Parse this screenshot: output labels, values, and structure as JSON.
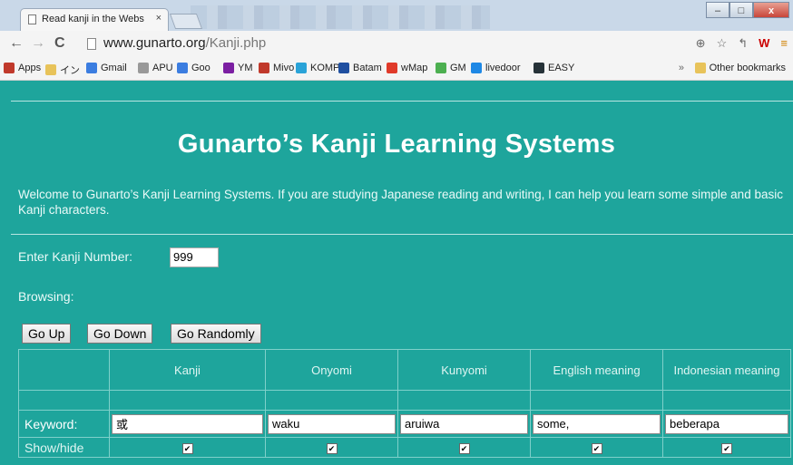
{
  "browser": {
    "tab_title": "Read kanji in the Webs",
    "tab_close": "×",
    "url_domain": "www.gunarto.org",
    "url_path": "/Kanji.php",
    "window_controls": [
      "–",
      "□",
      "x"
    ]
  },
  "bookmarks": [
    {
      "label": "Apps",
      "icon": "apps-icon",
      "color": "#c0392b"
    },
    {
      "label": "イン",
      "icon": "folder-icon",
      "color": "#e8c35a"
    },
    {
      "label": "Gmail",
      "icon": "google-icon",
      "color": "#3b7de0"
    },
    {
      "label": "APU",
      "icon": "page-icon",
      "color": "#999999"
    },
    {
      "label": "Goo",
      "icon": "google-icon",
      "color": "#3b7de0"
    },
    {
      "label": "YM",
      "icon": "yahoo-icon",
      "color": "#7b1fa2"
    },
    {
      "label": "Mivo",
      "icon": "mivo-icon",
      "color": "#c0392b"
    },
    {
      "label": "KOMP",
      "icon": "kompas-icon",
      "color": "#2aa3d8"
    },
    {
      "label": "Batam",
      "icon": "batam-icon",
      "color": "#1f4fa0"
    },
    {
      "label": "wMap",
      "icon": "wmap-icon",
      "color": "#e03a2a"
    },
    {
      "label": "GM",
      "icon": "gm-icon",
      "color": "#4caf50"
    },
    {
      "label": "livedoor",
      "icon": "livedoor-icon",
      "color": "#1e88e5"
    },
    {
      "label": "EASY",
      "icon": "easy-icon",
      "color": "#263238"
    }
  ],
  "bookmarks_overflow": "»",
  "other_bookmarks": "Other bookmarks",
  "page": {
    "title": "Gunarto’s Kanji Learning Systems",
    "welcome": "Welcome to Gunarto’s Kanji Learning Systems. If you are studying Japanese reading and writing, I can help you learn some simple and basic Kanji characters.",
    "kanji_number_label": "Enter Kanji Number:",
    "kanji_number_value": "999",
    "browsing_label": "Browsing:",
    "buttons": {
      "up": "Go Up",
      "down": "Go Down",
      "random": "Go Randomly"
    },
    "table": {
      "headers": [
        "Kanji",
        "Onyomi",
        "Kunyomi",
        "English meaning",
        "Indonesian meaning"
      ],
      "keyword_label": "Keyword:",
      "keyword_values": [
        "或",
        "waku",
        "aruiwa",
        "some,",
        "beberapa"
      ],
      "showhide_label": "Show/hide",
      "checkbox_mark": "✔"
    }
  },
  "colors": {
    "page_bg": "#1ea59c",
    "grid_line": "#7fd0ca"
  }
}
